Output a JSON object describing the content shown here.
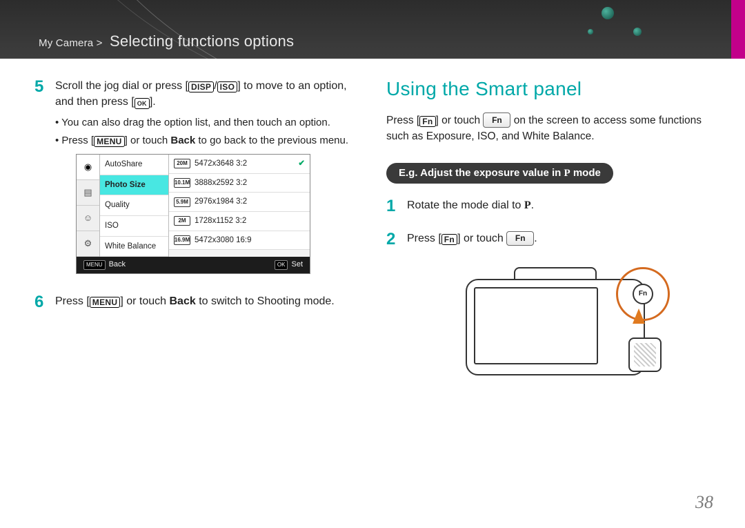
{
  "breadcrumb": {
    "root": "My Camera",
    "section": "Selecting functions options"
  },
  "step5": {
    "num": "5",
    "text_a": "Scroll the jog dial or press [",
    "disp": "DISP",
    "slash": "/",
    "iso": "ISO",
    "text_b": "] to move to an option, and then press [",
    "ok": "OK",
    "text_c": "].",
    "bullets": {
      "b1": "You can also drag the option list, and then touch an option.",
      "b2_a": "Press [",
      "b2_menu": "MENU",
      "b2_b": "] or touch ",
      "b2_back": "Back",
      "b2_c": " to go back to the previous menu."
    }
  },
  "lcd": {
    "side_active_idx": 0,
    "list": [
      "AutoShare",
      "Photo Size",
      "Quality",
      "ISO",
      "White Balance"
    ],
    "list_selected_idx": 1,
    "vals": [
      {
        "ico": "20M",
        "label": "5472x3648  3:2",
        "checked": true
      },
      {
        "ico": "10.1M",
        "label": "3888x2592  3:2",
        "checked": false
      },
      {
        "ico": "5.9M",
        "label": "2976x1984  3:2",
        "checked": false
      },
      {
        "ico": "2M",
        "label": "1728x1152  3:2",
        "checked": false
      },
      {
        "ico": "16.9M",
        "label": "5472x3080  16:9",
        "checked": false
      }
    ],
    "foot_back_badge": "MENU",
    "foot_back": "Back",
    "foot_set_badge": "OK",
    "foot_set": "Set"
  },
  "step6": {
    "num": "6",
    "text_a": "Press [",
    "menu": "MENU",
    "text_b": "] or touch ",
    "back": "Back",
    "text_c": " to switch to Shooting mode."
  },
  "right": {
    "heading": "Using the Smart panel",
    "intro_a": "Press [",
    "intro_fn_badge": "Fn",
    "intro_b": "] or touch ",
    "intro_fn_btn": "Fn",
    "intro_c": " on the screen to access some functions such as Exposure, ISO, and White Balance.",
    "pill_a": "E.g. Adjust the exposure value in ",
    "pill_P": "P",
    "pill_b": " mode",
    "s1": {
      "num": "1",
      "text_a": "Rotate the mode dial to ",
      "P": "P",
      "text_b": "."
    },
    "s2": {
      "num": "2",
      "text_a": "Press [",
      "fn_badge": "Fn",
      "text_b": "] or touch ",
      "fn_btn": "Fn",
      "text_c": "."
    },
    "cam_fn_label": "Fn"
  },
  "page_number": "38"
}
